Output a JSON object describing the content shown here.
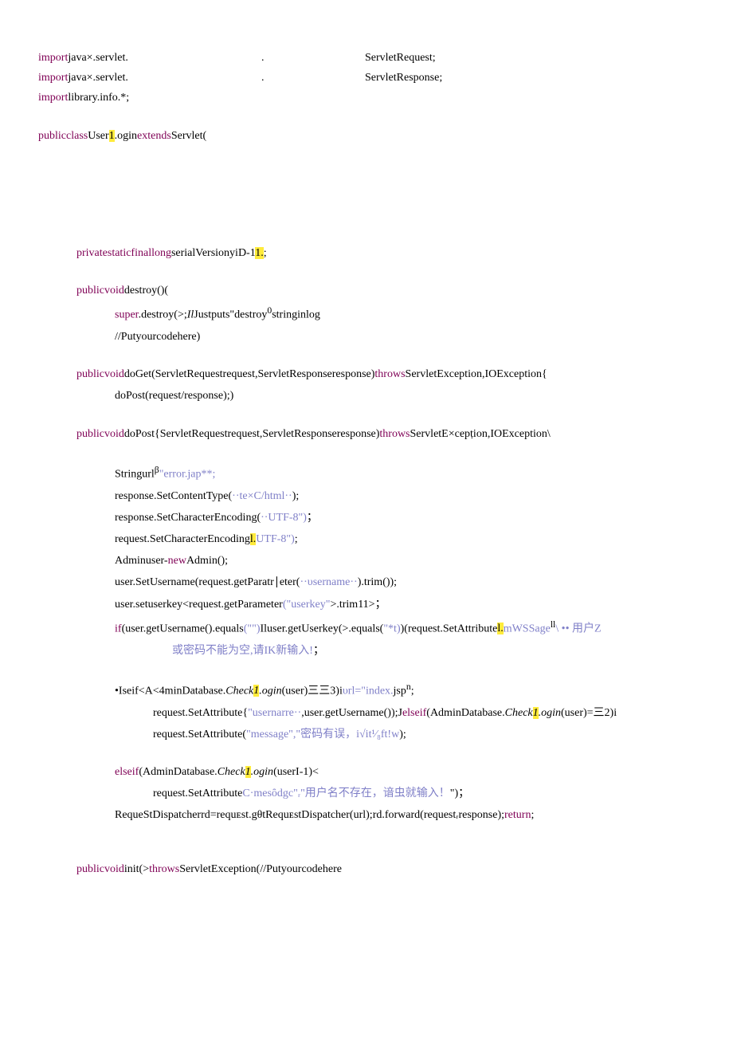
{
  "lines": {
    "l1a": "import",
    "l1b": "java×.servlet.",
    "l1c": ".",
    "l1d": "ServletRequest;",
    "l2a": "import",
    "l2b": "java×.servlet.",
    "l2c": ".",
    "l2d": "ServletResponse;",
    "l3a": "import",
    "l3b": "library.info.*;",
    "l4a": "public",
    "l4b": "class",
    "l4c": "User",
    "l4d": "1",
    "l4e": ".ogin",
    "l4f": "extends",
    "l4g": "Servlet(",
    "l5a": "private",
    "l5b": "static",
    "l5c": "final",
    "l5d": "long",
    "l5e": "serialVersionyiD-1",
    "l5f": "1.",
    "l5g": ";",
    "l6a": "public",
    "l6b": "void",
    "l6c": "destroy()(",
    "l7a": "super",
    "l7b": ".destroy(>;",
    "l7c": "Il",
    "l7d": "Justputs\"destroy",
    "l7e": "0",
    "l7f": "stringinlog",
    "l8a": "//Putyourcodehere)",
    "l9a": "public",
    "l9b": "void",
    "l9c": "doGet(ServletRequestrequest,ServletResponseresponse)",
    "l9d": "throws",
    "l9e": "ServletException,IOException{",
    "l10a": "doPost(request/response);)",
    "l11a": "public",
    "l11b": "void",
    "l11c": "doPost{ServletRequestrequest,ServletResponseresponse)",
    "l11d": "throws",
    "l11e": "ServletE×cepṭion,IOException\\",
    "l12a": "Stringurl",
    "l12b": "β",
    "l12c": "\"error.jap**;",
    "l13a": "response.SetContentType(",
    "l13b": "··te×C/html··",
    "l13c": ");",
    "l14a": "response.SetCharacterEncoding(",
    "l14b": "··UTF-8\")",
    "l14c": "；",
    "l15a": "request.SetCharacterEncoding",
    "l15b": "l.",
    "l15c": "UTF-8\")",
    "l15d": ";",
    "l16a": "Adminuser-",
    "l16b": "new",
    "l16c": "Admin();",
    "l17a": "user.SetUsername(request.getParatr∣eter(",
    "l17b": "··υsername··",
    "l17c": ").trim());",
    "l18a": "user.setuserkey<request.getParameter",
    "l18b": "(\"userkey\"",
    "l18c": ">.trim11>；",
    "l19a": "if",
    "l19b": "(user.getUsername().equals",
    "l19c": "(\"\")",
    "l19d": "Iluser.getUserkey(>.equals(",
    "l19e": "\"*t)",
    "l19f": ")(request.SetAttribute",
    "l19g": "l.",
    "l19h": "mWSSage",
    "l19i": "ll",
    "l19j": "\\ •• ",
    "l19k": "用户Z",
    "l20a": "或密码不能为空,请IK新输入!",
    "l20b": "；",
    "l21a": "•Iseif<A<4minDatabase.",
    "l21b": "Check",
    "l21c": "1",
    "l21d": ".ogin",
    "l21e": "(user)三三3)i",
    "l21f": "υrl=\"index.",
    "l21g": "jsp",
    "l21h": "n",
    "l21i": ";",
    "l22a": "request.SetAttribute{",
    "l22b": "\"usernarre··",
    "l22c": ",user.getUsername());J",
    "l22d": "elseif",
    "l22e": "(AdminDatabase.",
    "l22f": "Check",
    "l22g": "1",
    "l22h": ".ogin",
    "l22i": "(user)=三2)i",
    "l23a": "request.SetAttribute(",
    "l23b": "\"message\",\"",
    "l23c": "密码有误，i√it¹⁄₈ft!w",
    "l23d": ");",
    "l24a": "elseif",
    "l24b": "(AdminDatabase.",
    "l24c": "Check",
    "l24d": "1",
    "l24e": ".ogin",
    "l24f": "(userI-1)<",
    "l25a": "request.SetAttribute",
    "l25b": "C·mesȏdgc\"ᵣ\"",
    "l25c": "用户名不存在，谙虫就输入！",
    "l25d": "\")；",
    "l26a": "RequeStDispatcherrd=requᴇst.gθtRequᴇstDispatcher(url);rd.forward(requestᵣresponse);",
    "l26b": "return",
    "l26c": ";",
    "l27a": "public",
    "l27b": "void",
    "l27c": "init(>",
    "l27d": "throws",
    "l27e": "ServletException(//Putyourcodehere"
  }
}
